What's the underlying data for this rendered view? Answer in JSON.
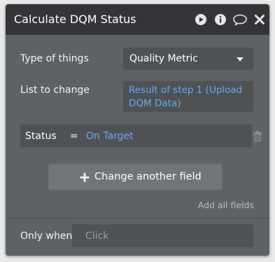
{
  "window": {
    "title": "Calculate DQM Status",
    "icons": [
      "play-icon",
      "info-icon",
      "comment-icon",
      "close-icon"
    ]
  },
  "form": {
    "type_label": "Type of things",
    "type_value": "Quality Metric",
    "list_label": "List to change",
    "list_value": "Result of step 1 (Upload DQM Data)"
  },
  "fields": [
    {
      "key": "Status",
      "operator": "=",
      "value": "On Target"
    }
  ],
  "actions": {
    "change_another_field": "Change another field",
    "add_all_fields": "Add all fields"
  },
  "condition": {
    "label": "Only when",
    "placeholder": "Click"
  },
  "colors": {
    "panel_bg": "#5f6265",
    "titlebar_bg": "#333538",
    "input_bg": "#4f5255",
    "dynamic_text": "#6aa7f2",
    "button_bg": "#727578"
  }
}
